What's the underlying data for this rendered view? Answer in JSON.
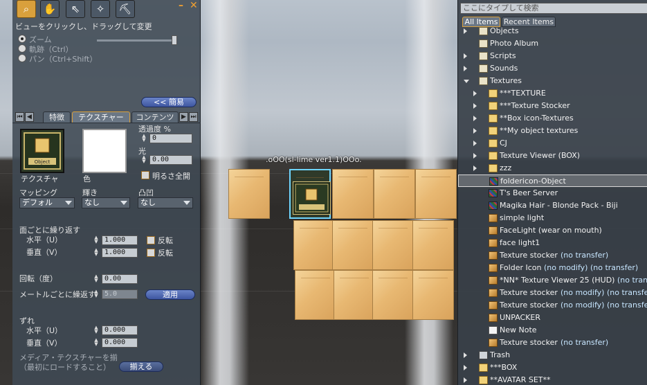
{
  "world": {
    "float_label": ".oOO(sl-lime ver1.1)OOo."
  },
  "build": {
    "view_hint": "ビューをクリックし、ドラッグして変更",
    "radio_options": [
      {
        "label": "ズーム",
        "selected": true
      },
      {
        "label": "軌跡（Ctrl）",
        "selected": false
      },
      {
        "label": "パン（Ctrl+Shift）",
        "selected": false
      }
    ],
    "zoom_slider_value": 1.0,
    "simple_button": "<< 簡易",
    "tabs": [
      "特徴",
      "テクスチャー",
      "コンテンツ"
    ],
    "active_tab": "テクスチャー",
    "texture_label": "テクスチャ",
    "color_label": "色",
    "transparency_label": "透過度 %",
    "transparency_value": "0",
    "glow_label": "光",
    "glow_value": "0.00",
    "fullbright_label": "明るさ全開",
    "mapping_label": "マッピング",
    "mapping_value": "デフォル",
    "shininess_label": "輝き",
    "shininess_value": "なし",
    "bumpiness_label": "凸凹",
    "bumpiness_value": "なし",
    "repeat_per_face_label": "面ごとに繰り返す",
    "horizontal_u_label": "水平（U）",
    "vertical_v_label": "垂直（V）",
    "repeat_u_value": "1.000",
    "repeat_v_value": "1.000",
    "flip_label": "反転",
    "rotation_label": "回転（度）",
    "rotation_value": "0.00",
    "repeats_per_meter_label": "メートルごとに繰返す",
    "repeats_per_meter_value": "5.0",
    "apply_button": "適用",
    "offset_label": "ずれ",
    "offset_u_value": "0.000",
    "offset_v_value": "0.000",
    "media_texture_label": "メディア・テクスチャーを揃",
    "media_texture_hint": "（最初にロードすること）",
    "align_button": "揃える"
  },
  "inventory": {
    "search_placeholder": "ここにタイプして検索",
    "tabs": [
      "All Items",
      "Recent Items"
    ],
    "active_tab": "All Items",
    "rows": [
      {
        "depth": 1,
        "twisty": "closed",
        "icon": "sysfolder",
        "name": "Objects",
        "perm": ""
      },
      {
        "depth": 1,
        "twisty": "none",
        "icon": "sysfolder",
        "name": "Photo Album",
        "perm": ""
      },
      {
        "depth": 1,
        "twisty": "closed",
        "icon": "sysfolder",
        "name": "Scripts",
        "perm": ""
      },
      {
        "depth": 1,
        "twisty": "closed",
        "icon": "sysfolder",
        "name": "Sounds",
        "perm": ""
      },
      {
        "depth": 1,
        "twisty": "open",
        "icon": "sysfolder",
        "name": "Textures",
        "perm": ""
      },
      {
        "depth": 2,
        "twisty": "closed",
        "icon": "folder",
        "name": "***TEXTURE",
        "perm": ""
      },
      {
        "depth": 2,
        "twisty": "closed",
        "icon": "folder",
        "name": "***Texture Stocker",
        "perm": ""
      },
      {
        "depth": 2,
        "twisty": "closed",
        "icon": "folder",
        "name": "**Box icon-Textures",
        "perm": ""
      },
      {
        "depth": 2,
        "twisty": "closed",
        "icon": "folder",
        "name": "**My object textures",
        "perm": ""
      },
      {
        "depth": 2,
        "twisty": "closed",
        "icon": "folder",
        "name": "CJ",
        "perm": ""
      },
      {
        "depth": 2,
        "twisty": "closed",
        "icon": "folder",
        "name": "Texture Viewer (BOX)",
        "perm": ""
      },
      {
        "depth": 2,
        "twisty": "closed",
        "icon": "folder",
        "name": "zzz",
        "perm": ""
      },
      {
        "depth": 2,
        "twisty": "none",
        "icon": "texture",
        "name": "foldericon-Object",
        "perm": "",
        "selected": true
      },
      {
        "depth": 2,
        "twisty": "none",
        "icon": "texture",
        "name": "T's Beer Server",
        "perm": ""
      },
      {
        "depth": 2,
        "twisty": "none",
        "icon": "texture",
        "name": "Magika Hair - Blonde Pack - Biji",
        "perm": ""
      },
      {
        "depth": 2,
        "twisty": "none",
        "icon": "object",
        "name": "simple light",
        "perm": ""
      },
      {
        "depth": 2,
        "twisty": "none",
        "icon": "object",
        "name": "FaceLight (wear on mouth)",
        "perm": ""
      },
      {
        "depth": 2,
        "twisty": "none",
        "icon": "object",
        "name": "face light1",
        "perm": ""
      },
      {
        "depth": 2,
        "twisty": "none",
        "icon": "object",
        "name": "Texture stocker",
        "perm": "(no transfer)"
      },
      {
        "depth": 2,
        "twisty": "none",
        "icon": "object",
        "name": "Folder Icon",
        "perm": "(no modify) (no transfer)"
      },
      {
        "depth": 2,
        "twisty": "none",
        "icon": "object",
        "name": "*NN* Texture Viewer 25 (HUD)",
        "perm": "(no transfer)"
      },
      {
        "depth": 2,
        "twisty": "none",
        "icon": "object",
        "name": "Texture stocker",
        "perm": "(no modify) (no transfer)"
      },
      {
        "depth": 2,
        "twisty": "none",
        "icon": "object",
        "name": "Texture stocker",
        "perm": "(no modify) (no transfer)"
      },
      {
        "depth": 2,
        "twisty": "none",
        "icon": "object",
        "name": "UNPACKER",
        "perm": ""
      },
      {
        "depth": 2,
        "twisty": "none",
        "icon": "note",
        "name": "New Note",
        "perm": ""
      },
      {
        "depth": 2,
        "twisty": "none",
        "icon": "object",
        "name": "Texture stocker",
        "perm": "(no transfer)"
      },
      {
        "depth": 1,
        "twisty": "closed",
        "icon": "trash",
        "name": "Trash",
        "perm": ""
      },
      {
        "depth": 1,
        "twisty": "closed",
        "icon": "folder",
        "name": "***BOX",
        "perm": ""
      },
      {
        "depth": 1,
        "twisty": "closed",
        "icon": "folder",
        "name": "**AVATAR SET**",
        "perm": ""
      }
    ]
  }
}
